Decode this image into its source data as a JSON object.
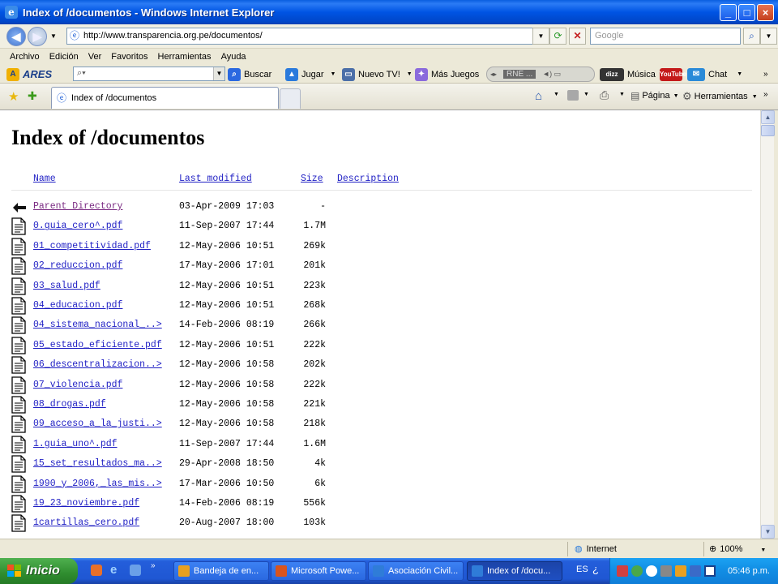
{
  "window": {
    "title": "Index of /documentos - Windows Internet Explorer",
    "min_glyph": "_",
    "max_glyph": "□",
    "close_glyph": "×"
  },
  "addressbar": {
    "url": "http://www.transparencia.org.pe/documentos/",
    "search_placeholder": "Google",
    "back_glyph": "◀",
    "forward_glyph": "▶"
  },
  "menu": [
    "Archivo",
    "Edición",
    "Ver",
    "Favoritos",
    "Herramientas",
    "Ayuda"
  ],
  "ares_toolbar": {
    "logo": "ARES",
    "search_label": "Buscar",
    "jugar": "Jugar",
    "nuevo_tv": "Nuevo TV!",
    "mas_juegos": "Más Juegos",
    "radio": "RNE ...",
    "musica": "Música",
    "chat": "Chat",
    "youtube": "YouTube"
  },
  "tabs": {
    "active_title": "Index of /documentos"
  },
  "commandbar": {
    "pagina": "Página",
    "herramientas": "Herramientas"
  },
  "page": {
    "heading": "Index of /documentos",
    "columns": {
      "name": "Name",
      "modified": "Last modified",
      "size": "Size",
      "description": "Description"
    },
    "rows": [
      {
        "name": "Parent Directory",
        "date": "03-Apr-2009 17:03",
        "size": "-",
        "kind": "parent"
      },
      {
        "name": "0.guia_cero^.pdf",
        "date": "11-Sep-2007 17:44",
        "size": "1.7M",
        "kind": "file"
      },
      {
        "name": "01_competitividad.pdf",
        "date": "12-May-2006 10:51",
        "size": "269k",
        "kind": "file"
      },
      {
        "name": "02_reduccion.pdf",
        "date": "17-May-2006 17:01",
        "size": "201k",
        "kind": "file"
      },
      {
        "name": "03_salud.pdf",
        "date": "12-May-2006 10:51",
        "size": "223k",
        "kind": "file"
      },
      {
        "name": "04_educacion.pdf",
        "date": "12-May-2006 10:51",
        "size": "268k",
        "kind": "file"
      },
      {
        "name": "04_sistema_nacional_..>",
        "date": "14-Feb-2006 08:19",
        "size": "266k",
        "kind": "file"
      },
      {
        "name": "05_estado_eficiente.pdf",
        "date": "12-May-2006 10:51",
        "size": "222k",
        "kind": "file"
      },
      {
        "name": "06_descentralizacion..>",
        "date": "12-May-2006 10:58",
        "size": "202k",
        "kind": "file"
      },
      {
        "name": "07_violencia.pdf",
        "date": "12-May-2006 10:58",
        "size": "222k",
        "kind": "file"
      },
      {
        "name": "08_drogas.pdf",
        "date": "12-May-2006 10:58",
        "size": "221k",
        "kind": "file"
      },
      {
        "name": "09_acceso_a_la_justi..>",
        "date": "12-May-2006 10:58",
        "size": "218k",
        "kind": "file"
      },
      {
        "name": "1.guia_uno^.pdf",
        "date": "11-Sep-2007 17:44",
        "size": "1.6M",
        "kind": "file"
      },
      {
        "name": "15_set_resultados_ma..>",
        "date": "29-Apr-2008 18:50",
        "size": "4k",
        "kind": "file"
      },
      {
        "name": "1990_y_2006,_las_mis..>",
        "date": "17-Mar-2006 10:50",
        "size": "6k",
        "kind": "file"
      },
      {
        "name": "19_23_noviembre.pdf",
        "date": "14-Feb-2006 08:19",
        "size": "556k",
        "kind": "file"
      },
      {
        "name": "1cartillas_cero.pdf",
        "date": "20-Aug-2007 18:00",
        "size": "103k",
        "kind": "file"
      }
    ]
  },
  "statusbar": {
    "zone": "Internet",
    "zoom": "100%"
  },
  "taskbar": {
    "start": "Inicio",
    "tasks": [
      {
        "label": "Bandeja de en...",
        "color": "#e8a020"
      },
      {
        "label": "Microsoft Powe...",
        "color": "#d9541e"
      },
      {
        "label": "Asociación Civil...",
        "color": "#2f7cd8"
      },
      {
        "label": "Index of /docu...",
        "color": "#2f7cd8"
      }
    ],
    "language": "ES",
    "clock": "05:46 p.m."
  },
  "colors": {
    "link": "#1f1fc4",
    "visited_link": "#7a2a82",
    "titlebar": "#0054e3",
    "taskbar": "#245edb"
  }
}
